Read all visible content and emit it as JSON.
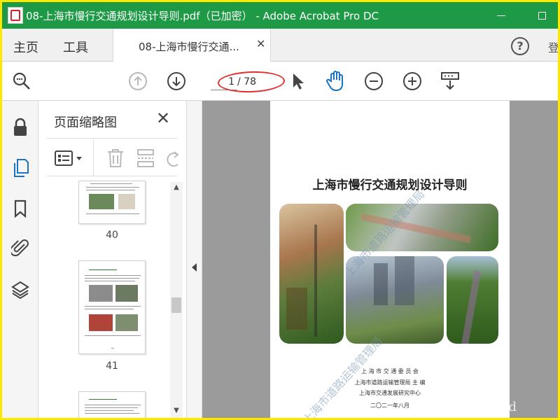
{
  "window": {
    "title": "08-上海市慢行交通规划设计导则.pdf（已加密） - Adobe Acrobat Pro DC"
  },
  "nav": {
    "home": "主页",
    "tools": "工具",
    "doc_tab": "08-上海市慢行交通...",
    "extra_tab": "登"
  },
  "toolbar": {
    "page_current": "1",
    "page_total": "/ 78",
    "icons": [
      "search-zoom-icon",
      "prev-page-icon",
      "next-page-icon",
      "select-cursor-icon",
      "hand-tool-icon",
      "zoom-out-icon",
      "zoom-in-icon",
      "keyboard-scroll-icon"
    ]
  },
  "rail": {
    "icons": [
      "lock-icon",
      "page-thumbnails-icon",
      "bookmark-icon",
      "attachment-icon",
      "layers-icon"
    ]
  },
  "thumbnails": {
    "title": "页面缩略图",
    "pages": [
      {
        "number": "40"
      },
      {
        "number": "41"
      }
    ]
  },
  "document": {
    "title": "上海市慢行交通规划设计导则",
    "credits": [
      "上 海 市 交 通 委 员 会",
      "上海市道路运输管理局 主 编",
      "上海市交通发展研究中心",
      "二〇二一年八月"
    ],
    "watermark": "上海市道路运输管理局"
  },
  "corner_watermark": "www.cnd",
  "colors": {
    "titlebar": "#1e9a46",
    "highlight": "#e03030",
    "outer_border": "#ffe800",
    "active_rail_icon": "#1a73c9"
  }
}
